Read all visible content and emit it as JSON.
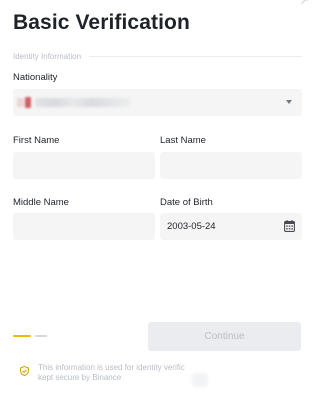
{
  "corner_glyph": "↗",
  "page": {
    "title": "Basic Verification",
    "section_label": "Identity Information"
  },
  "form": {
    "nationality": {
      "label": "Nationality"
    },
    "first_name": {
      "label": "First Name",
      "value": ""
    },
    "last_name": {
      "label": "Last Name",
      "value": ""
    },
    "middle_name": {
      "label": "Middle Name",
      "value": ""
    },
    "date_of_birth": {
      "label": "Date of Birth",
      "value": "2003-05-24"
    }
  },
  "stepper": {
    "current_step": 1,
    "total_steps": 2,
    "active_color": "#f0b90b",
    "inactive_color": "#d5d8dc"
  },
  "actions": {
    "continue_label": "Continue",
    "continue_enabled": false
  },
  "notice": {
    "line1": "This information is used for identity verific",
    "line2": "kept secure by Binance"
  },
  "icons": {
    "nationality_dropdown": "chevron-down-icon",
    "date_picker": "calendar-icon",
    "notice": "shield-check-icon"
  }
}
